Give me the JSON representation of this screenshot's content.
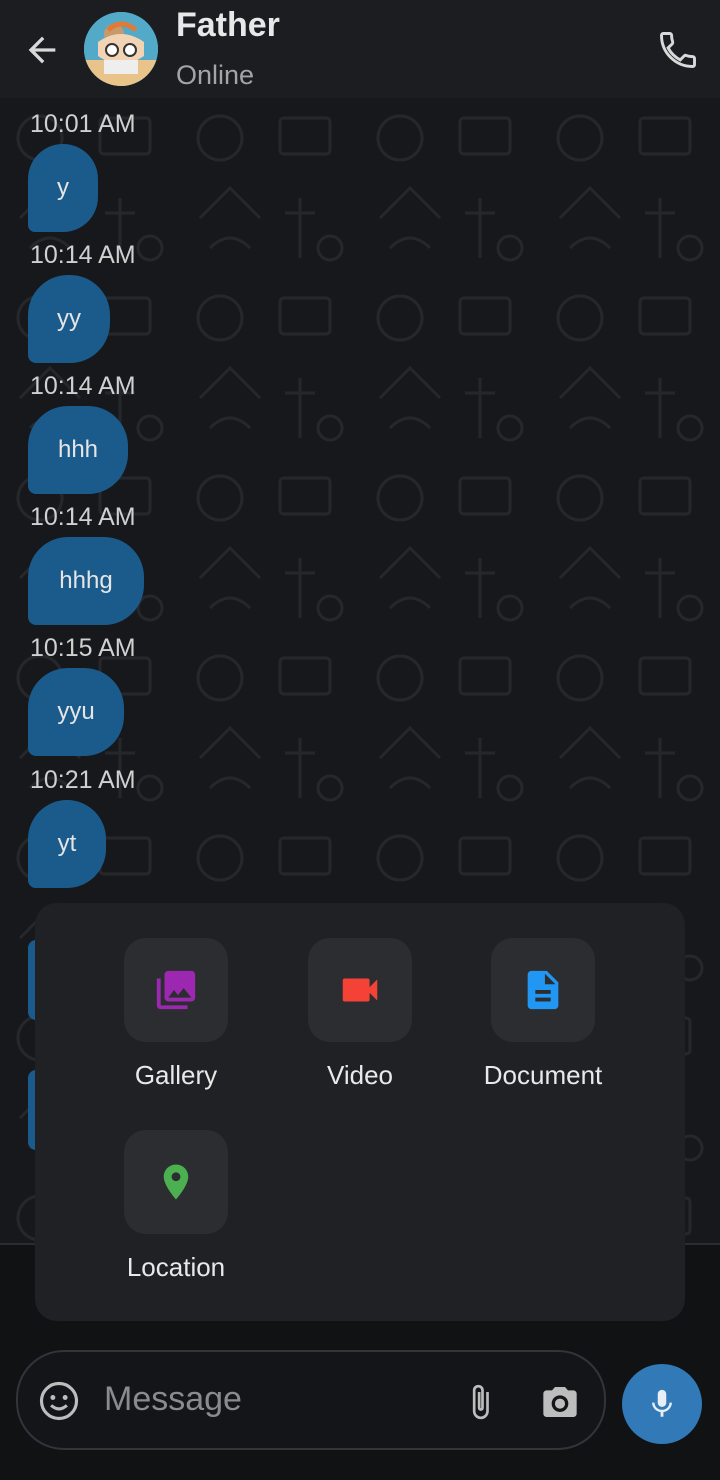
{
  "header": {
    "name": "Father",
    "status": "Online"
  },
  "messages": [
    {
      "time": "10:01 AM",
      "text": "y"
    },
    {
      "time": "10:14 AM",
      "text": "yy"
    },
    {
      "time": "10:14 AM",
      "text": "hhh"
    },
    {
      "time": "10:14 AM",
      "text": "hhhg"
    },
    {
      "time": "10:15 AM",
      "text": "yyu"
    },
    {
      "time": "10:21 AM",
      "text": "yt"
    }
  ],
  "attach_menu": {
    "gallery": "Gallery",
    "video": "Video",
    "document": "Document",
    "location": "Location"
  },
  "composer": {
    "placeholder": "Message"
  },
  "colors": {
    "bubble": "#1b5b8c",
    "gallery_icon": "#9c27b0",
    "video_icon": "#f44336",
    "document_icon": "#2196f3",
    "location_icon": "#4caf50",
    "mic_button": "#3279b8"
  },
  "icons": [
    "back-arrow-icon",
    "phone-icon",
    "gallery-icon",
    "video-icon",
    "document-icon",
    "location-icon",
    "emoji-icon",
    "paperclip-icon",
    "camera-icon",
    "microphone-icon"
  ]
}
